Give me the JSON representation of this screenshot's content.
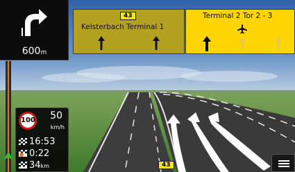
{
  "turn": {
    "distance_value": "600",
    "distance_unit": "m"
  },
  "signs": {
    "left": {
      "route_number": "43",
      "text": "Kelsterbach Terminal 1"
    },
    "right": {
      "text": "Terminal 2 Tor 2 - 3"
    }
  },
  "trip": {
    "speed_limit": "100",
    "speed": "50",
    "speed_unit": "km/h",
    "arrival_time": "16:53",
    "remaining_time": "0:22",
    "remaining_distance": "34",
    "remaining_distance_unit": "km"
  },
  "road_shield": "43",
  "colors": {
    "sign_left": "#b4a120",
    "sign_right": "#ffd500",
    "speed_limit_ring": "#d11818",
    "progress_line": "#e8731d",
    "sky_top": "#3c6fb4",
    "grass": "#5d8d3e"
  },
  "icons": [
    "turn-arrow-icon",
    "airplane-icon",
    "straight-arrow-icon",
    "finish-flag-icon",
    "menu-icon"
  ]
}
